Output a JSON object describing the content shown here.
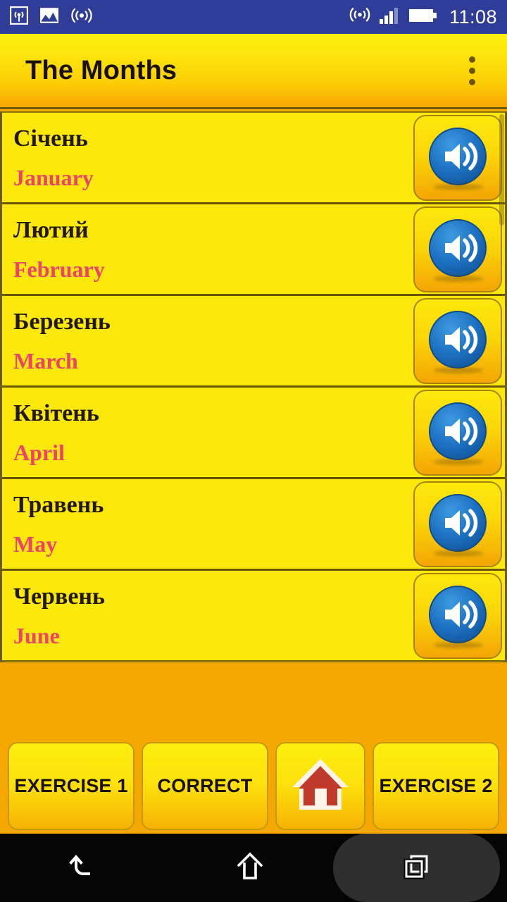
{
  "status_bar": {
    "time": "11:08",
    "left_icons": [
      "broadcast-icon",
      "photo-icon",
      "wireless-icon"
    ],
    "right_icons": [
      "hotspot-icon",
      "signal-bars-icon",
      "battery-icon"
    ],
    "background_color": "#2F3D99"
  },
  "app_bar": {
    "title": "The Months",
    "overflow_icon": "overflow-menu-icon",
    "accent_color": "#FCD506"
  },
  "list": {
    "items": [
      {
        "native": "Січень",
        "translation": "January",
        "speak_icon": "speaker-icon"
      },
      {
        "native": "Лютий",
        "translation": "February",
        "speak_icon": "speaker-icon"
      },
      {
        "native": "Березень",
        "translation": "March",
        "speak_icon": "speaker-icon"
      },
      {
        "native": "Квітень",
        "translation": "April",
        "speak_icon": "speaker-icon"
      },
      {
        "native": "Травень",
        "translation": "May",
        "speak_icon": "speaker-icon"
      },
      {
        "native": "Червень",
        "translation": "June",
        "speak_icon": "speaker-icon"
      }
    ],
    "native_color": "#231A06",
    "translation_color": "#EB4469"
  },
  "bottom_bar": {
    "buttons": [
      {
        "label": "EXERCISE 1",
        "icon": null
      },
      {
        "label": "CORRECT",
        "icon": null
      },
      {
        "label": "",
        "icon": "home-house-icon"
      },
      {
        "label": "EXERCISE 2",
        "icon": null
      }
    ]
  },
  "nav_bar": {
    "back_icon": "back-arrow-icon",
    "home_icon": "home-outline-icon",
    "recents_icon": "recents-squares-icon"
  }
}
